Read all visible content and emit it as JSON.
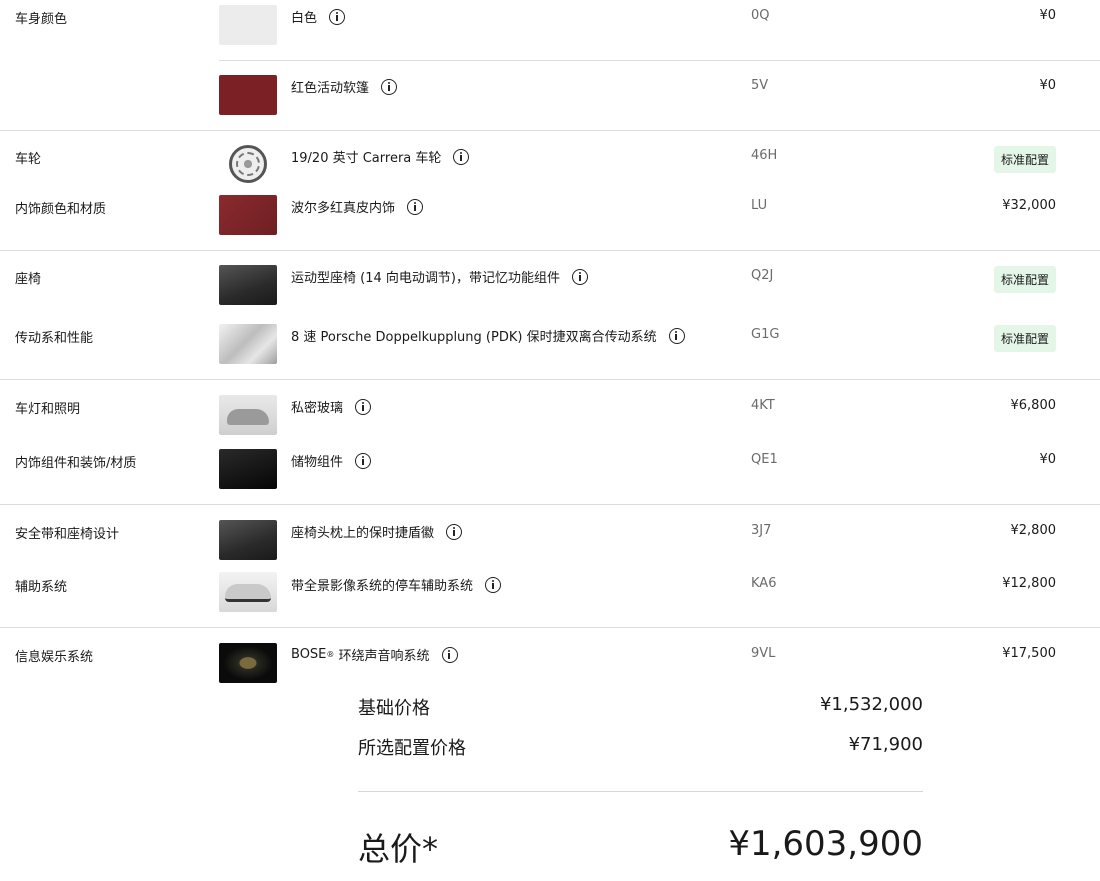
{
  "rows": [
    {
      "category": "车身颜色",
      "option": "白色",
      "code": "0Q",
      "price": "¥0",
      "thumb": "white-swatch"
    },
    {
      "category": "",
      "option": "红色活动软篷",
      "code": "5V",
      "price": "¥0",
      "thumb": "red-swatch"
    },
    {
      "category": "车轮",
      "option": "19/20 英寸 Carrera 车轮",
      "code": "46H",
      "badge": "标准配置",
      "thumb": "wheel"
    },
    {
      "category": "内饰颜色和材质",
      "option": "波尔多红真皮内饰",
      "code": "LU",
      "price": "¥32,000",
      "thumb": "red-leather-swatch"
    },
    {
      "category": "座椅",
      "option": "运动型座椅 (14 向电动调节)，带记忆功能组件",
      "code": "Q2J",
      "badge": "标准配置",
      "thumb": "seat"
    },
    {
      "category": "传动系和性能",
      "option": "8 速 Porsche Doppelkupplung (PDK) 保时捷双离合传动系统",
      "code": "G1G",
      "badge": "标准配置",
      "thumb": "gearbox"
    },
    {
      "category": "车灯和照明",
      "option": "私密玻璃",
      "code": "4KT",
      "price": "¥6,800",
      "thumb": "car"
    },
    {
      "category": "内饰组件和装饰/材质",
      "option": "储物组件",
      "code": "QE1",
      "price": "¥0",
      "thumb": "storage"
    },
    {
      "category": "安全带和座椅设计",
      "option": "座椅头枕上的保时捷盾徽",
      "code": "3J7",
      "price": "¥2,800",
      "thumb": "seat"
    },
    {
      "category": "辅助系统",
      "option": "带全景影像系统的停车辅助系统",
      "code": "KA6",
      "price": "¥12,800",
      "thumb": "car"
    },
    {
      "category": "信息娱乐系统",
      "option": "BOSE",
      "option_sup": "®",
      "option_suffix": " 环绕声音响系统",
      "code": "9VL",
      "price": "¥17,500",
      "thumb": "bose"
    }
  ],
  "summary": {
    "base_label": "基础价格",
    "base_value": "¥1,532,000",
    "options_label": "所选配置价格",
    "options_value": "¥71,900",
    "total_label": "总价*",
    "total_value": "¥1,603,900"
  },
  "icons": {
    "info": "info-icon"
  },
  "colors": {
    "badge_bg": "#e4f6e8",
    "code_text": "#6b6b6b",
    "divider": "#dddddd"
  }
}
